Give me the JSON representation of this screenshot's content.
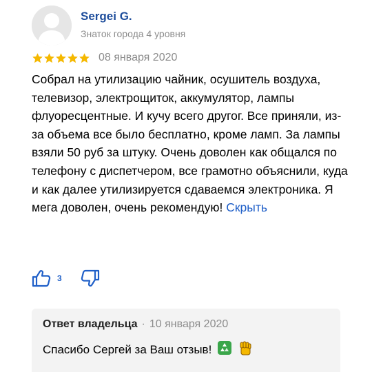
{
  "author": {
    "name": "Sergei G.",
    "level": "Знаток города 4 уровня"
  },
  "review": {
    "rating": 5,
    "rating_max": 5,
    "date": "08 января 2020",
    "text": "Собрал на утилизацию чайник, осушитель воздуха, телевизор, электрощиток, аккумулятор, лампы флуоресцентные. И кучу всего другог. Все приняли, из-за объема все было бесплатно, кроме ламп. За лампы взяли 50 руб за штуку. Очень доволен как общался по телефону с диспетчером, все грамотно объяснили, куда и как далее утилизируется сдаваемся электроника. Я мега доволен, очень рекомендую!",
    "hide_label": "Скрыть"
  },
  "reactions": {
    "likes": "3"
  },
  "owner_reply": {
    "title": "Ответ владельца",
    "separator": "·",
    "date": "10 января 2020",
    "text": "Спасибо Сергей за Ваш отзыв!"
  },
  "icons": {
    "avatar": "person-silhouette-icon",
    "star": "star-icon",
    "like": "thumbs-up-icon",
    "dislike": "thumbs-down-icon",
    "recycle": "recycle-emoji-icon",
    "fist": "raised-fist-emoji-icon"
  },
  "colors": {
    "author_name": "#1f4e9c",
    "link": "#1f5fc8",
    "star": "#f5b800",
    "muted": "#8c8c8c",
    "reply_background": "#f3f3f3"
  }
}
